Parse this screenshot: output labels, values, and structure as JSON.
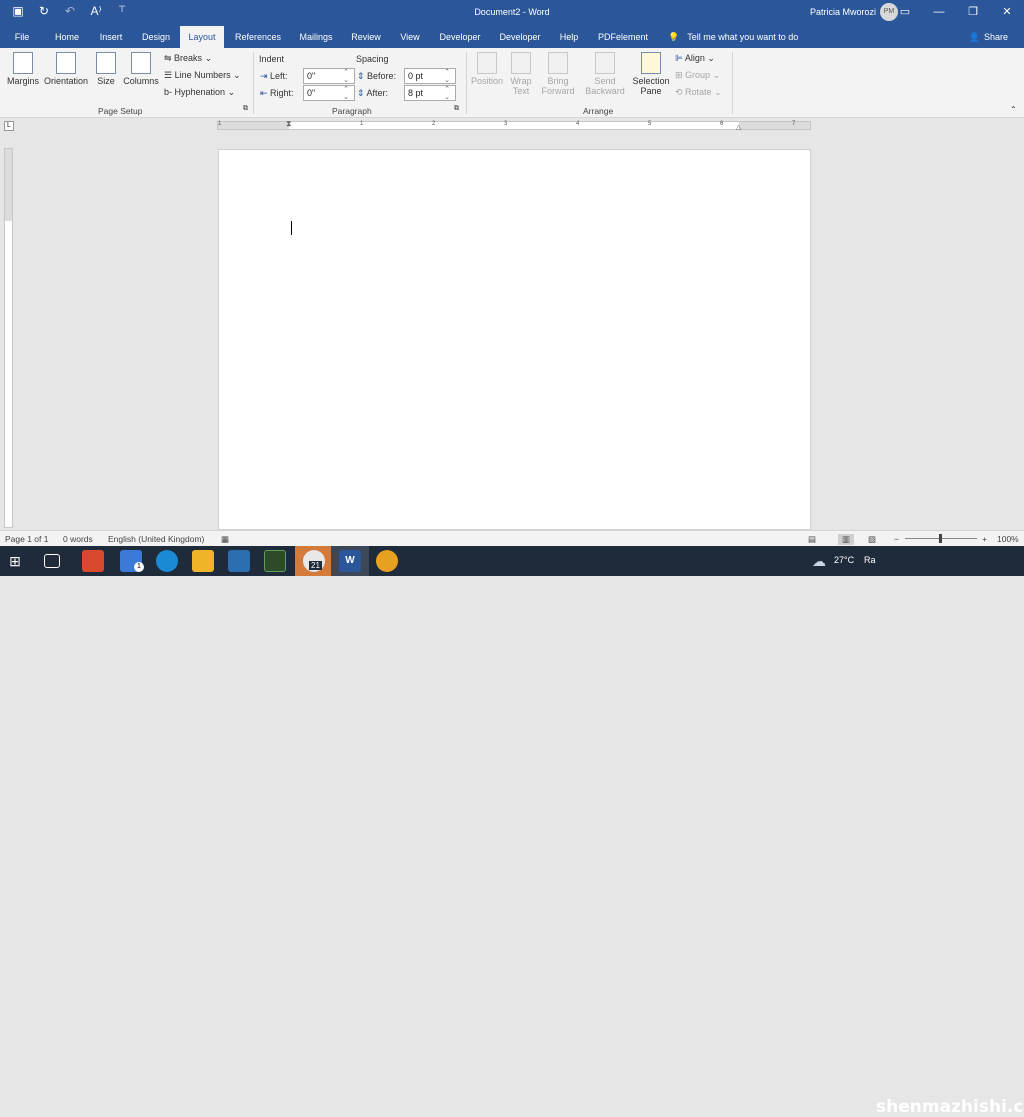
{
  "titlebar": {
    "doc_title": "Document2 - Word",
    "user_name": "Patricia Mworozi",
    "user_initials": "PM",
    "qat_icons": [
      "save-icon",
      "autosave-icon",
      "undo-icon",
      "read-aloud-icon",
      "customize-icon"
    ]
  },
  "tabs": [
    "File",
    "Home",
    "Insert",
    "Design",
    "Layout",
    "References",
    "Mailings",
    "Review",
    "View",
    "Developer",
    "Developer",
    "Help",
    "PDFelement"
  ],
  "active_tab": "Layout",
  "tell_me": "Tell me what you want to do",
  "share": "Share",
  "ribbon": {
    "page_setup": {
      "label": "Page Setup",
      "margins": "Margins",
      "orientation": "Orientation",
      "size": "Size",
      "columns": "Columns",
      "breaks": "Breaks",
      "line_numbers": "Line Numbers",
      "hyphenation": "Hyphenation"
    },
    "paragraph": {
      "label": "Paragraph",
      "indent": "Indent",
      "spacing": "Spacing",
      "left_label": "Left:",
      "left_value": "0\"",
      "right_label": "Right:",
      "right_value": "0\"",
      "before_label": "Before:",
      "before_value": "0 pt",
      "after_label": "After:",
      "after_value": "8 pt"
    },
    "arrange": {
      "label": "Arrange",
      "position": "Position",
      "wrap_text_1": "Wrap",
      "wrap_text_2": "Text",
      "bring_forward_1": "Bring",
      "bring_forward_2": "Forward",
      "send_backward_1": "Send",
      "send_backward_2": "Backward",
      "selection_pane_1": "Selection",
      "selection_pane_2": "Pane",
      "align": "Align",
      "group": "Group",
      "rotate": "Rotate"
    }
  },
  "ruler": {
    "h_labels": [
      "1",
      "1",
      "2",
      "3",
      "4",
      "5",
      "6",
      "7"
    ],
    "tab_selector": "L"
  },
  "status": {
    "page": "Page 1 of 1",
    "words": "0 words",
    "language": "English (United Kingdom)",
    "zoom": "100%",
    "zoom_minus": "−",
    "zoom_plus": "+"
  },
  "taskbar": {
    "mail_badge": "1",
    "calendar_badge": "21",
    "temperature": "27°C",
    "weather_text": "Ra",
    "watermark": "shenmazhishi.com"
  },
  "colors": {
    "word_blue": "#2b579a",
    "ribbon_bg": "#f3f3f3",
    "taskbar": "#1f2a3a"
  }
}
